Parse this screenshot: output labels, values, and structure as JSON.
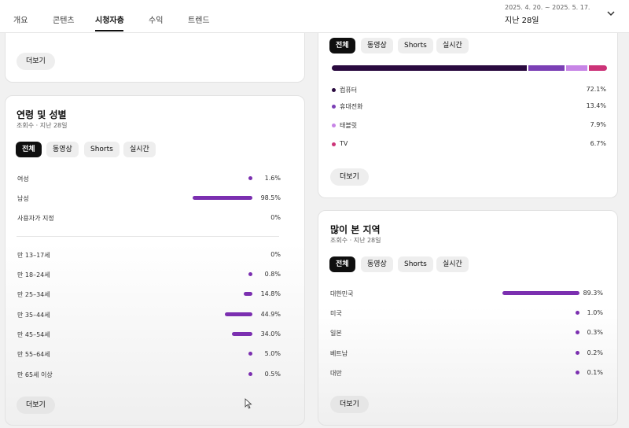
{
  "nav": {
    "tabs": [
      {
        "label": "개요"
      },
      {
        "label": "콘텐츠"
      },
      {
        "label": "시청자층"
      },
      {
        "label": "수익"
      },
      {
        "label": "트렌드"
      }
    ],
    "active_tab": "시청자층",
    "date_range": "2025. 4. 20. ~ 2025. 5. 17.",
    "date_label": "지난 28일"
  },
  "top_left_card": {
    "more_label": "더보기"
  },
  "age_gender_card": {
    "title": "연령 및 성별",
    "subtitle": "조회수 · 지난 28일",
    "chips": [
      "전체",
      "동영상",
      "Shorts",
      "실시간"
    ],
    "gender": [
      {
        "label": "여성",
        "value": "1.6%",
        "pct": 1.6
      },
      {
        "label": "남성",
        "value": "98.5%",
        "pct": 98.5
      },
      {
        "label": "사용자가 지정",
        "value": "0%",
        "pct": 0
      }
    ],
    "age": [
      {
        "label": "만 13–17세",
        "value": "0%",
        "pct": 0
      },
      {
        "label": "만 18–24세",
        "value": "0.8%",
        "pct": 0.8
      },
      {
        "label": "만 25–34세",
        "value": "14.8%",
        "pct": 14.8
      },
      {
        "label": "만 35–44세",
        "value": "44.9%",
        "pct": 44.9
      },
      {
        "label": "만 45–54세",
        "value": "34.0%",
        "pct": 34.0
      },
      {
        "label": "만 55–64세",
        "value": "5.0%",
        "pct": 5.0
      },
      {
        "label": "만 65세 이상",
        "value": "0.5%",
        "pct": 0.5
      }
    ],
    "more_label": "더보기"
  },
  "device_card": {
    "chips": [
      "전체",
      "동영상",
      "Shorts",
      "실시간"
    ],
    "devices": [
      {
        "label": "컴퓨터",
        "value": "72.1%",
        "pct": 72.1,
        "color": "#2a0a3f"
      },
      {
        "label": "휴대전화",
        "value": "13.4%",
        "pct": 13.4,
        "color": "#7b3fb5"
      },
      {
        "label": "태블릿",
        "value": "7.9%",
        "pct": 7.9,
        "color": "#c785e6"
      },
      {
        "label": "TV",
        "value": "6.7%",
        "pct": 6.7,
        "color": "#cc3378"
      }
    ],
    "more_label": "더보기"
  },
  "geo_card": {
    "title": "많이 본 지역",
    "subtitle": "조회수 · 지난 28일",
    "chips": [
      "전체",
      "동영상",
      "Shorts",
      "실시간"
    ],
    "regions": [
      {
        "label": "대한민국",
        "value": "89.3%",
        "pct": 89.3
      },
      {
        "label": "미국",
        "value": "1.0%",
        "pct": 1.0
      },
      {
        "label": "일본",
        "value": "0.3%",
        "pct": 0.3
      },
      {
        "label": "베트남",
        "value": "0.2%",
        "pct": 0.2
      },
      {
        "label": "대만",
        "value": "0.1%",
        "pct": 0.1
      }
    ],
    "more_label": "더보기"
  },
  "colors": {
    "accent": "#7b2fb0",
    "chip_active_bg": "#0f0f0f"
  }
}
